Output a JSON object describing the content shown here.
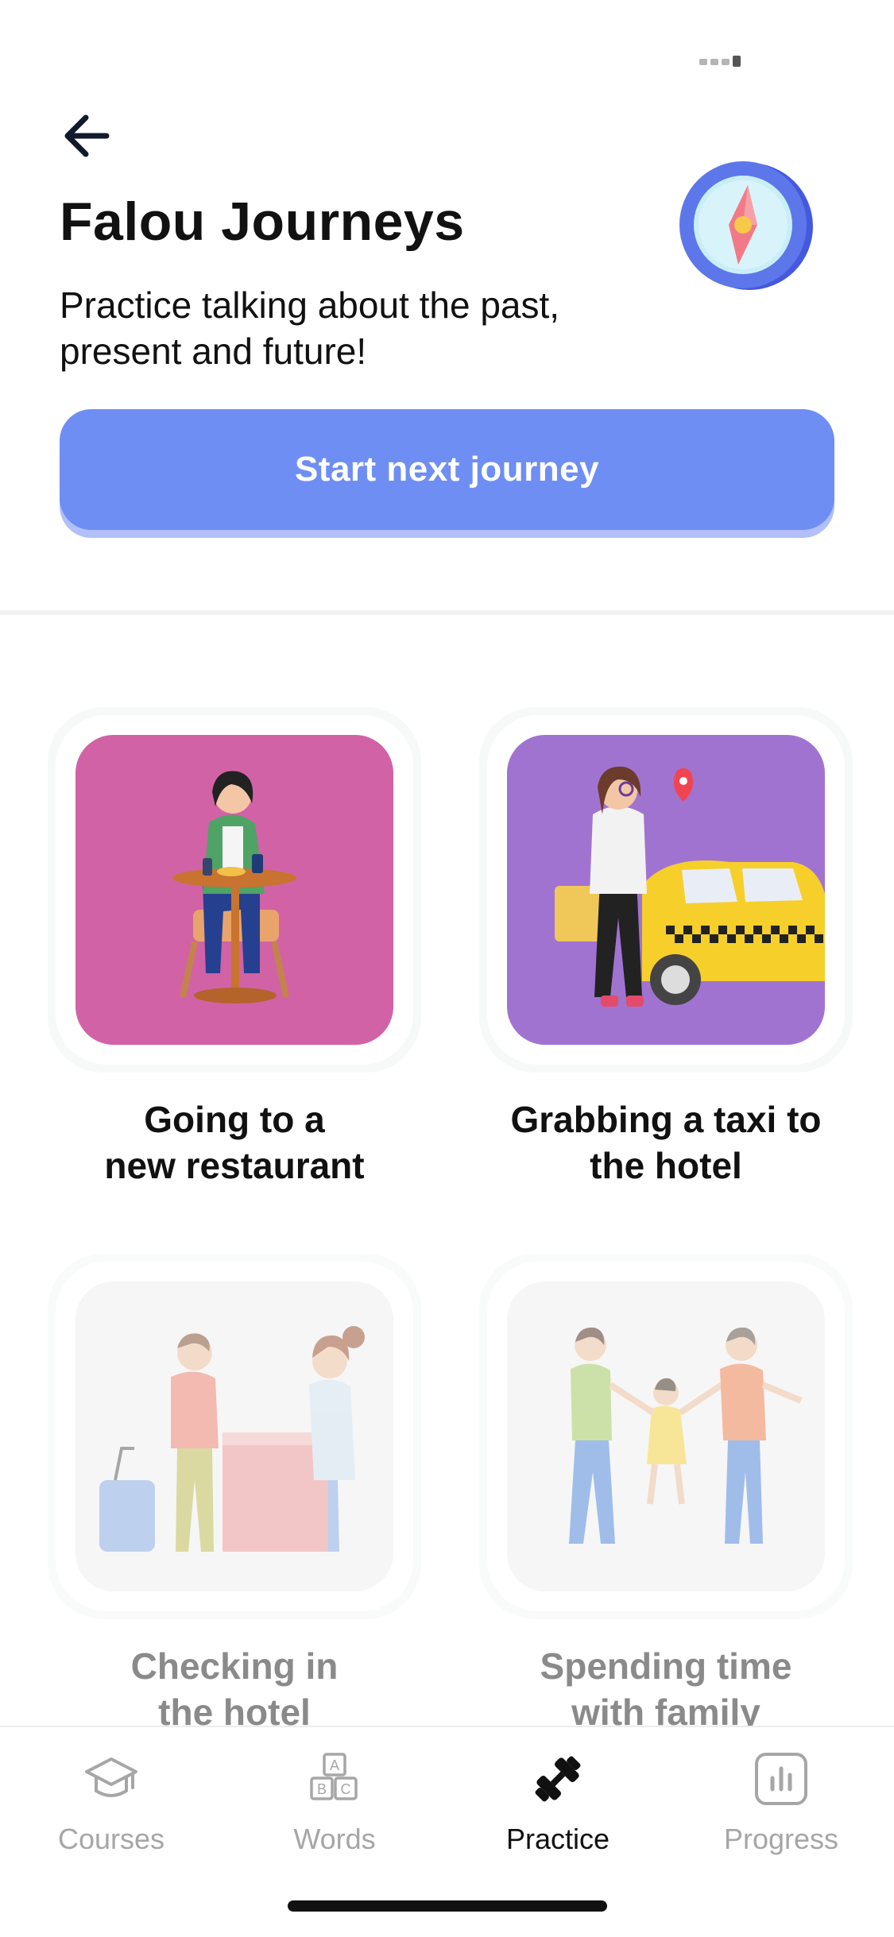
{
  "header": {
    "title": "Falou Journeys",
    "subtitle": "Practice talking about the past, present and future!",
    "cta_label": "Start next journey"
  },
  "journeys": [
    {
      "label_line1": "Going to a",
      "label_line2": "new restaurant",
      "locked": false,
      "bg": "#d262a6"
    },
    {
      "label_line1": "Grabbing a taxi to",
      "label_line2": "the hotel",
      "locked": false,
      "bg": "#a173d1"
    },
    {
      "label_line1": "Checking in",
      "label_line2": "the hotel",
      "locked": true,
      "bg": "#f6f6f6"
    },
    {
      "label_line1": "Spending time",
      "label_line2": "with family",
      "locked": true,
      "bg": "#f6f6f6"
    }
  ],
  "tabs": [
    {
      "label": "Courses",
      "icon": "graduation-cap-icon",
      "active": false
    },
    {
      "label": "Words",
      "icon": "abc-blocks-icon",
      "active": false
    },
    {
      "label": "Practice",
      "icon": "dumbbell-icon",
      "active": true
    },
    {
      "label": "Progress",
      "icon": "bar-chart-icon",
      "active": false
    }
  ],
  "colors": {
    "accent": "#6f8ef3",
    "accent_shadow": "#b1bffa",
    "compass_ring": "#4f67e8"
  }
}
